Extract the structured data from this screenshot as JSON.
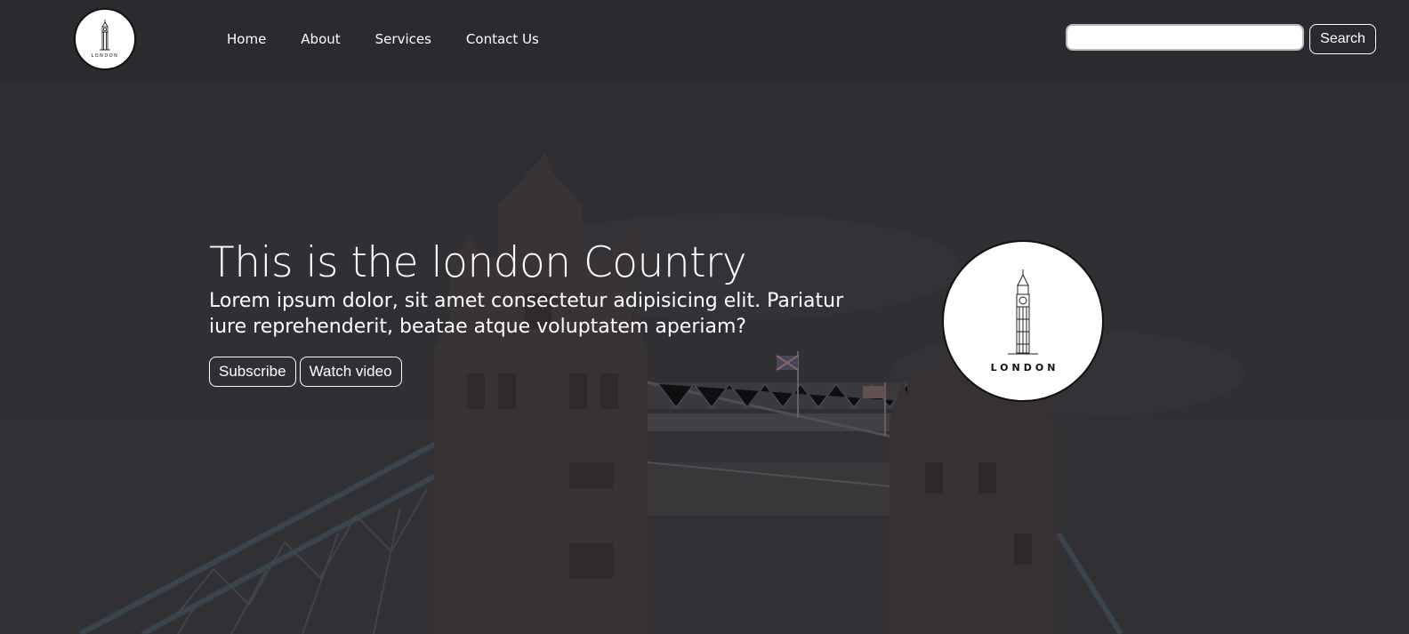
{
  "nav": {
    "logo_text": "LONDON",
    "links": [
      "Home",
      "About",
      "Services",
      "Contact Us"
    ],
    "search": {
      "placeholder": "",
      "value": "",
      "button_label": "Search"
    }
  },
  "hero": {
    "title": "This is the london Country",
    "subtitle": "Lorem ipsum dolor, sit amet consectetur adipisicing elit. Pariatur iure reprehenderit, beatae atque voluptatem aperiam?",
    "buttons": {
      "subscribe": "Subscribe",
      "watch_video": "Watch video"
    },
    "logo_text": "LONDON"
  },
  "colors": {
    "overlay": "#3a393c",
    "text": "#ffffff",
    "accent_border": "#ffffff"
  },
  "icons": {
    "logo": "big-ben-tower-icon",
    "background": "tower-bridge-photo"
  }
}
